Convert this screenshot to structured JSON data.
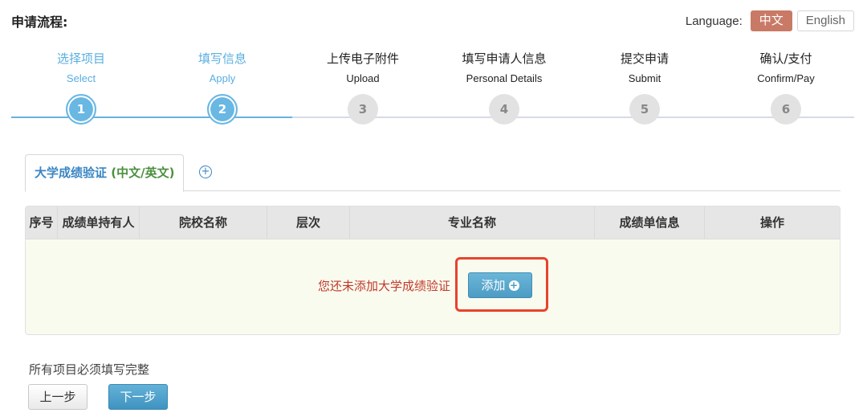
{
  "header": {
    "title": "申请流程:",
    "language_label": "Language:",
    "languages": [
      {
        "label": "中文",
        "active": true
      },
      {
        "label": "English",
        "active": false
      }
    ]
  },
  "stepper": {
    "current_step": 2,
    "total_steps": 6,
    "steps": [
      {
        "cn": "选择项目",
        "en": "Select",
        "number": "1",
        "status": "done"
      },
      {
        "cn": "填写信息",
        "en": "Apply",
        "number": "2",
        "status": "done"
      },
      {
        "cn": "上传电子附件",
        "en": "Upload",
        "number": "3",
        "status": "todo"
      },
      {
        "cn": "填写申请人信息",
        "en": "Personal Details",
        "number": "4",
        "status": "todo"
      },
      {
        "cn": "提交申请",
        "en": "Submit",
        "number": "5",
        "status": "todo"
      },
      {
        "cn": "确认/支付",
        "en": "Confirm/Pay",
        "number": "6",
        "status": "todo"
      }
    ]
  },
  "tabs": {
    "active": {
      "title_main": "大学成绩验证",
      "title_suffix": "(中文/英文)"
    },
    "add_icon": "plus-circle-icon",
    "add_glyph": "+"
  },
  "table": {
    "columns": [
      "序号",
      "成绩单持有人",
      "院校名称",
      "层次",
      "专业名称",
      "成绩单信息",
      "操作"
    ],
    "rows": [],
    "empty_message": "您还未添加大学成绩验证",
    "add_button_label": "添加",
    "add_button_icon": "plus-circle-icon",
    "add_button_glyph": "+"
  },
  "footer": {
    "note": "所有项目必须填写完整",
    "prev_label": "上一步",
    "next_label": "下一步"
  },
  "colors": {
    "accent_blue": "#69b7e3",
    "lang_active": "#c97a66",
    "empty_message": "#c0392b",
    "highlight_box": "#e8432d",
    "tab_title_blue": "#3a86c4",
    "tab_title_green": "#4b8f3d"
  }
}
